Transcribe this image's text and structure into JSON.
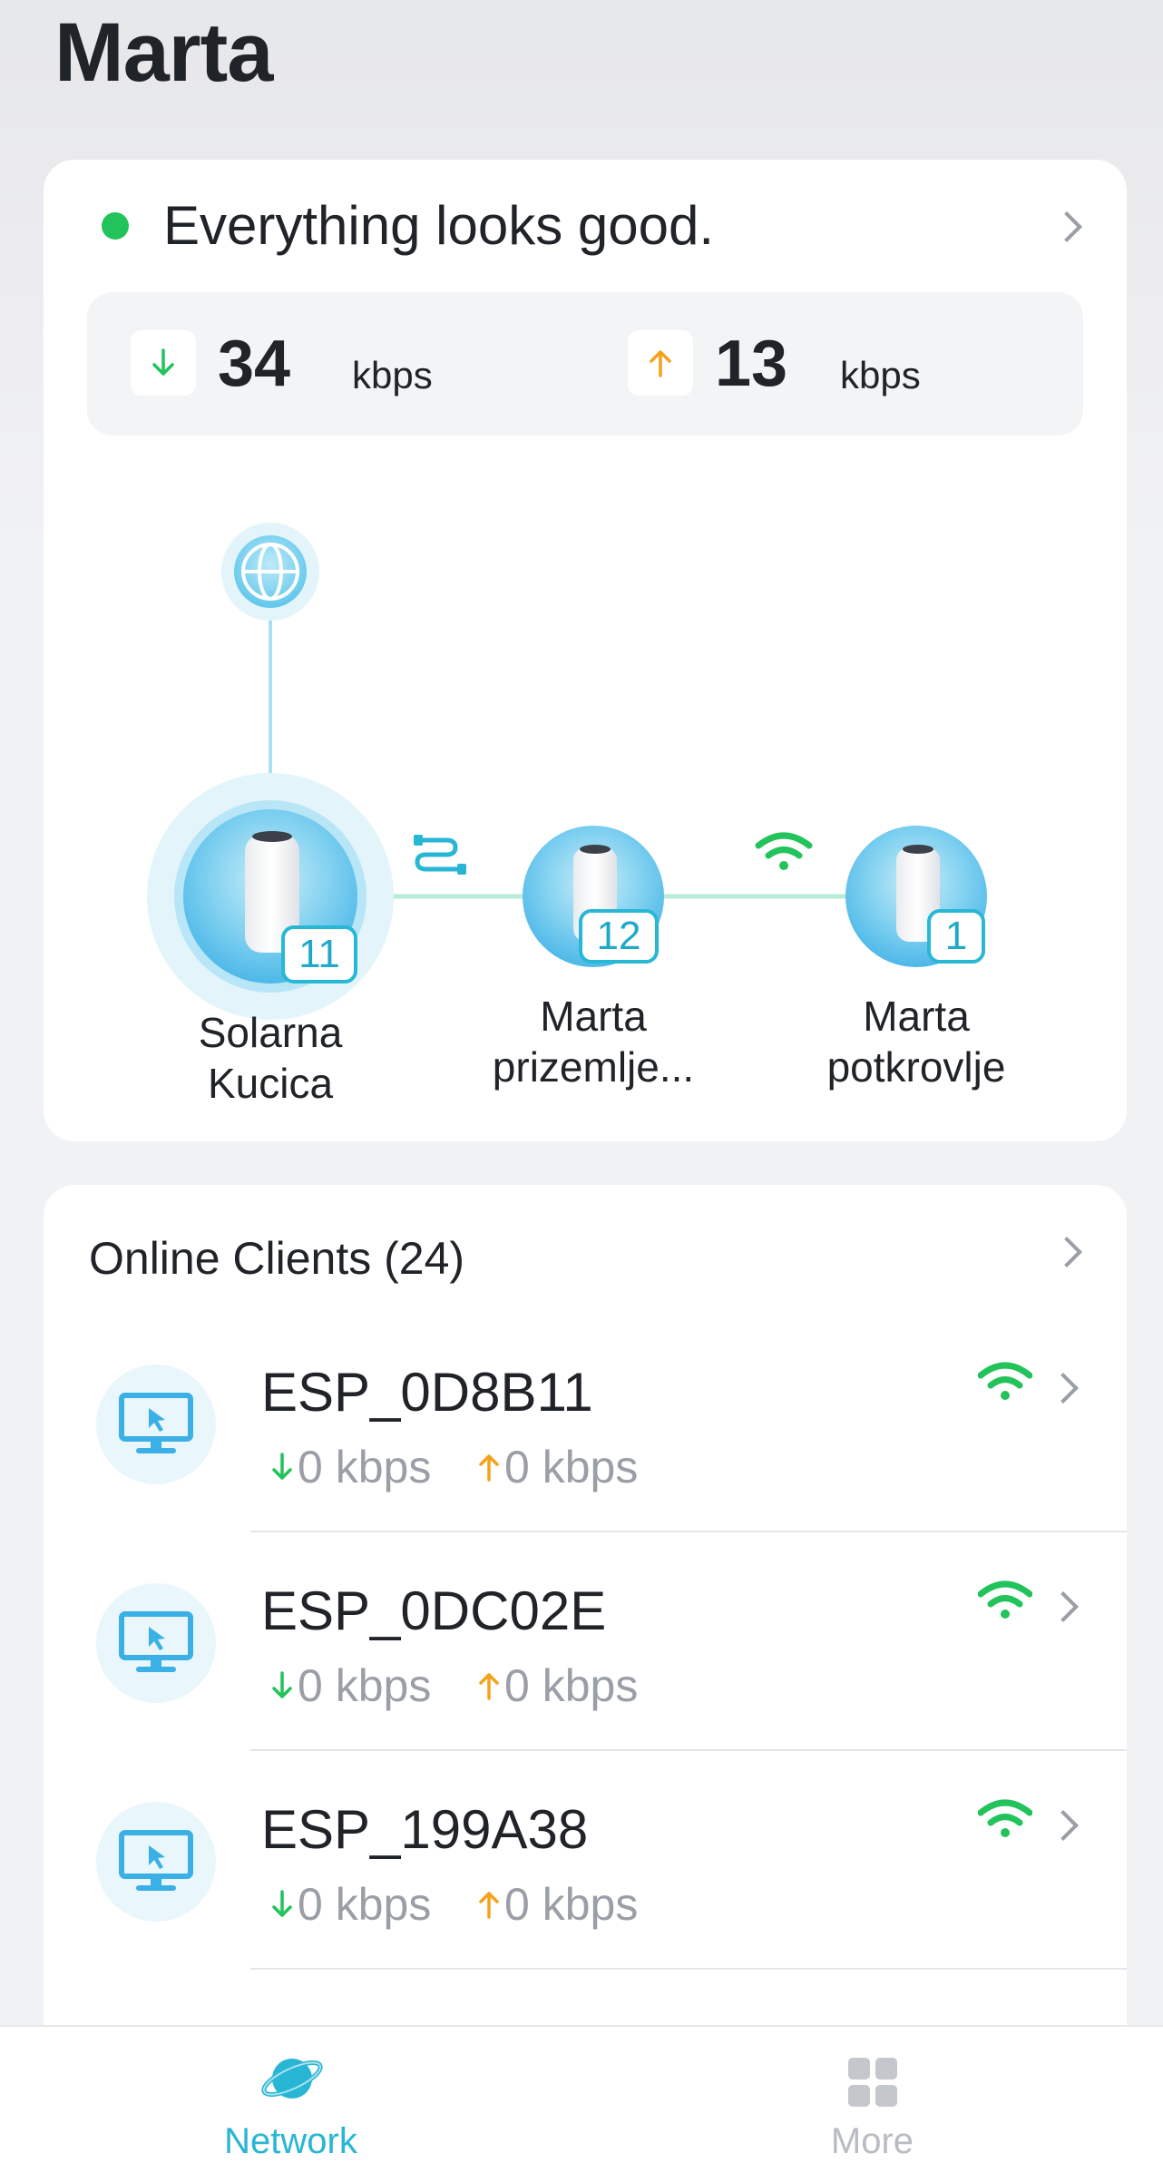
{
  "header": {
    "title": "Marta"
  },
  "status": {
    "message": "Everything looks good.",
    "download_value": "34",
    "download_unit": "kbps",
    "upload_value": "13",
    "upload_unit": "kbps"
  },
  "topology": {
    "nodes": [
      {
        "name_line1": "Solarna",
        "name_line2": "Kucica",
        "clients": "11"
      },
      {
        "name_line1": "Marta",
        "name_line2": "prizemlje...",
        "clients": "12"
      },
      {
        "name_line1": "Marta",
        "name_line2": "potkrovlje",
        "clients": "1"
      }
    ]
  },
  "clients": {
    "title": "Online Clients (24)",
    "items": [
      {
        "name": "ESP_0D8B11",
        "down": "0 kbps",
        "up": "0 kbps"
      },
      {
        "name": "ESP_0DC02E",
        "down": "0 kbps",
        "up": "0 kbps"
      },
      {
        "name": "ESP_199A38",
        "down": "0 kbps",
        "up": "0 kbps"
      }
    ]
  },
  "tabbar": {
    "network_label": "Network",
    "more_label": "More"
  },
  "colors": {
    "accent": "#29b6d5",
    "status_good": "#22c35a",
    "download": "#22c35a",
    "upload": "#f5a21a",
    "inactive": "#b9bcc2"
  }
}
